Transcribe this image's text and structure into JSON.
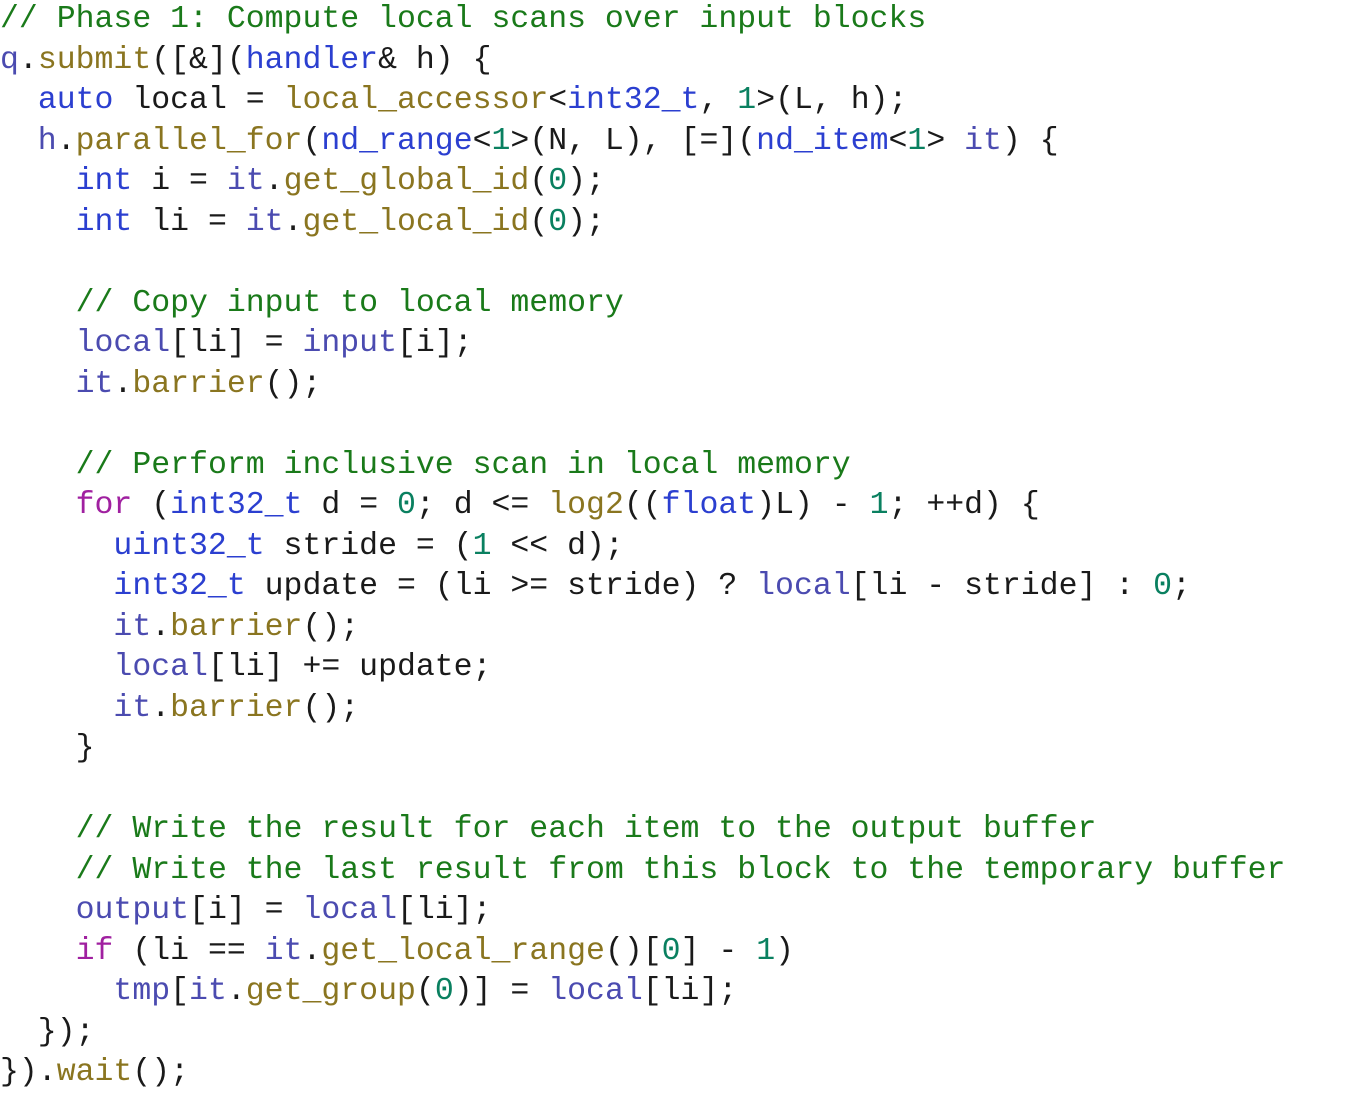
{
  "document": {
    "kind": "source-code-listing",
    "language": "C++ / SYCL",
    "background_color": "#ffffff",
    "theme": {
      "comment_color": "#1a7a1a",
      "keyword_color": "#2b3fd0",
      "control_keyword_color": "#a020a0",
      "function_color": "#8a7520",
      "identifier_color": "#4b4bb0",
      "number_color": "#0a8060",
      "plain_color": "#1a1a1a"
    }
  },
  "code": {
    "full_text": "// Phase 1: Compute local scans over input blocks\nq.submit([&](handler& h) {\n  auto local = local_accessor<int32_t, 1>(L, h);\n  h.parallel_for(nd_range<1>(N, L), [=](nd_item<1> it) {\n    int i = it.get_global_id(0);\n    int li = it.get_local_id(0);\n\n    // Copy input to local memory\n    local[li] = input[i];\n    it.barrier();\n\n    // Perform inclusive scan in local memory\n    for (int32_t d = 0; d <= log2((float)L) - 1; ++d) {\n      uint32_t stride = (1 << d);\n      int32_t update = (li >= stride) ? local[li - stride] : 0;\n      it.barrier();\n      local[li] += update;\n      it.barrier();\n    }\n\n    // Write the result for each item to the output buffer\n    // Write the last result from this block to the temporary buffer\n    output[i] = local[li];\n    if (li == it.get_local_range()[0] - 1)\n      tmp[it.get_group(0)] = local[li];\n  });\n}).wait();",
    "lines": [
      {
        "n": 1,
        "text": "// Phase 1: Compute local scans over input blocks",
        "tokens": [
          {
            "c": "cmt",
            "t": "// Phase 1: Compute local scans over input blocks"
          }
        ]
      },
      {
        "n": 2,
        "text": "q.submit([&](handler& h) {",
        "tokens": [
          {
            "c": "id",
            "t": "q"
          },
          {
            "c": "pl",
            "t": "."
          },
          {
            "c": "fn",
            "t": "submit"
          },
          {
            "c": "pl",
            "t": "([&]("
          },
          {
            "c": "kw",
            "t": "handler"
          },
          {
            "c": "pl",
            "t": "& h) {"
          }
        ]
      },
      {
        "n": 3,
        "text": "  auto local = local_accessor<int32_t, 1>(L, h);",
        "tokens": [
          {
            "c": "pl",
            "t": "  "
          },
          {
            "c": "kw",
            "t": "auto"
          },
          {
            "c": "pl",
            "t": " local = "
          },
          {
            "c": "fn",
            "t": "local_accessor"
          },
          {
            "c": "pl",
            "t": "<"
          },
          {
            "c": "kw",
            "t": "int32_t"
          },
          {
            "c": "pl",
            "t": ", "
          },
          {
            "c": "num",
            "t": "1"
          },
          {
            "c": "pl",
            "t": ">(L, h);"
          }
        ]
      },
      {
        "n": 4,
        "text": "  h.parallel_for(nd_range<1>(N, L), [=](nd_item<1> it) {",
        "tokens": [
          {
            "c": "id",
            "t": "  h"
          },
          {
            "c": "pl",
            "t": "."
          },
          {
            "c": "fn",
            "t": "parallel_for"
          },
          {
            "c": "pl",
            "t": "("
          },
          {
            "c": "kw",
            "t": "nd_range"
          },
          {
            "c": "pl",
            "t": "<"
          },
          {
            "c": "num",
            "t": "1"
          },
          {
            "c": "pl",
            "t": ">(N, L), [=]("
          },
          {
            "c": "kw",
            "t": "nd_item"
          },
          {
            "c": "pl",
            "t": "<"
          },
          {
            "c": "num",
            "t": "1"
          },
          {
            "c": "pl",
            "t": "> "
          },
          {
            "c": "id",
            "t": "it"
          },
          {
            "c": "pl",
            "t": ") {"
          }
        ]
      },
      {
        "n": 5,
        "text": "    int i = it.get_global_id(0);",
        "tokens": [
          {
            "c": "pl",
            "t": "    "
          },
          {
            "c": "kw",
            "t": "int"
          },
          {
            "c": "pl",
            "t": " i = "
          },
          {
            "c": "id",
            "t": "it"
          },
          {
            "c": "pl",
            "t": "."
          },
          {
            "c": "fn",
            "t": "get_global_id"
          },
          {
            "c": "pl",
            "t": "("
          },
          {
            "c": "num",
            "t": "0"
          },
          {
            "c": "pl",
            "t": ");"
          }
        ]
      },
      {
        "n": 6,
        "text": "    int li = it.get_local_id(0);",
        "tokens": [
          {
            "c": "pl",
            "t": "    "
          },
          {
            "c": "kw",
            "t": "int"
          },
          {
            "c": "pl",
            "t": " li = "
          },
          {
            "c": "id",
            "t": "it"
          },
          {
            "c": "pl",
            "t": "."
          },
          {
            "c": "fn",
            "t": "get_local_id"
          },
          {
            "c": "pl",
            "t": "("
          },
          {
            "c": "num",
            "t": "0"
          },
          {
            "c": "pl",
            "t": ");"
          }
        ]
      },
      {
        "n": 7,
        "text": "",
        "tokens": []
      },
      {
        "n": 8,
        "text": "    // Copy input to local memory",
        "tokens": [
          {
            "c": "pl",
            "t": "    "
          },
          {
            "c": "cmt",
            "t": "// Copy input to local memory"
          }
        ]
      },
      {
        "n": 9,
        "text": "    local[li] = input[i];",
        "tokens": [
          {
            "c": "pl",
            "t": "    "
          },
          {
            "c": "id",
            "t": "local"
          },
          {
            "c": "pl",
            "t": "[li] = "
          },
          {
            "c": "id",
            "t": "input"
          },
          {
            "c": "pl",
            "t": "[i];"
          }
        ]
      },
      {
        "n": 10,
        "text": "    it.barrier();",
        "tokens": [
          {
            "c": "pl",
            "t": "    "
          },
          {
            "c": "id",
            "t": "it"
          },
          {
            "c": "pl",
            "t": "."
          },
          {
            "c": "fn",
            "t": "barrier"
          },
          {
            "c": "pl",
            "t": "();"
          }
        ]
      },
      {
        "n": 11,
        "text": "",
        "tokens": []
      },
      {
        "n": 12,
        "text": "    // Perform inclusive scan in local memory",
        "tokens": [
          {
            "c": "pl",
            "t": "    "
          },
          {
            "c": "cmt",
            "t": "// Perform inclusive scan in local memory"
          }
        ]
      },
      {
        "n": 13,
        "text": "    for (int32_t d = 0; d <= log2((float)L) - 1; ++d) {",
        "tokens": [
          {
            "c": "pl",
            "t": "    "
          },
          {
            "c": "ctl",
            "t": "for"
          },
          {
            "c": "pl",
            "t": " ("
          },
          {
            "c": "kw",
            "t": "int32_t"
          },
          {
            "c": "pl",
            "t": " d = "
          },
          {
            "c": "num",
            "t": "0"
          },
          {
            "c": "pl",
            "t": "; d <= "
          },
          {
            "c": "fn",
            "t": "log2"
          },
          {
            "c": "pl",
            "t": "(("
          },
          {
            "c": "kw",
            "t": "float"
          },
          {
            "c": "pl",
            "t": ")L) - "
          },
          {
            "c": "num",
            "t": "1"
          },
          {
            "c": "pl",
            "t": "; ++d) {"
          }
        ]
      },
      {
        "n": 14,
        "text": "      uint32_t stride = (1 << d);",
        "tokens": [
          {
            "c": "pl",
            "t": "      "
          },
          {
            "c": "kw",
            "t": "uint32_t"
          },
          {
            "c": "pl",
            "t": " stride = ("
          },
          {
            "c": "num",
            "t": "1"
          },
          {
            "c": "pl",
            "t": " << d);"
          }
        ]
      },
      {
        "n": 15,
        "text": "      int32_t update = (li >= stride) ? local[li - stride] : 0;",
        "tokens": [
          {
            "c": "pl",
            "t": "      "
          },
          {
            "c": "kw",
            "t": "int32_t"
          },
          {
            "c": "pl",
            "t": " update = (li >= stride) ? "
          },
          {
            "c": "id",
            "t": "local"
          },
          {
            "c": "pl",
            "t": "[li - stride] : "
          },
          {
            "c": "num",
            "t": "0"
          },
          {
            "c": "pl",
            "t": ";"
          }
        ]
      },
      {
        "n": 16,
        "text": "      it.barrier();",
        "tokens": [
          {
            "c": "pl",
            "t": "      "
          },
          {
            "c": "id",
            "t": "it"
          },
          {
            "c": "pl",
            "t": "."
          },
          {
            "c": "fn",
            "t": "barrier"
          },
          {
            "c": "pl",
            "t": "();"
          }
        ]
      },
      {
        "n": 17,
        "text": "      local[li] += update;",
        "tokens": [
          {
            "c": "pl",
            "t": "      "
          },
          {
            "c": "id",
            "t": "local"
          },
          {
            "c": "pl",
            "t": "[li] += update;"
          }
        ]
      },
      {
        "n": 18,
        "text": "      it.barrier();",
        "tokens": [
          {
            "c": "pl",
            "t": "      "
          },
          {
            "c": "id",
            "t": "it"
          },
          {
            "c": "pl",
            "t": "."
          },
          {
            "c": "fn",
            "t": "barrier"
          },
          {
            "c": "pl",
            "t": "();"
          }
        ]
      },
      {
        "n": 19,
        "text": "    }",
        "tokens": [
          {
            "c": "pl",
            "t": "    }"
          }
        ]
      },
      {
        "n": 20,
        "text": "",
        "tokens": []
      },
      {
        "n": 21,
        "text": "    // Write the result for each item to the output buffer",
        "tokens": [
          {
            "c": "pl",
            "t": "    "
          },
          {
            "c": "cmt",
            "t": "// Write the result for each item to the output buffer"
          }
        ]
      },
      {
        "n": 22,
        "text": "    // Write the last result from this block to the temporary buffer",
        "tokens": [
          {
            "c": "pl",
            "t": "    "
          },
          {
            "c": "cmt",
            "t": "// Write the last result from this block to the temporary buffer"
          }
        ]
      },
      {
        "n": 23,
        "text": "    output[i] = local[li];",
        "tokens": [
          {
            "c": "pl",
            "t": "    "
          },
          {
            "c": "id",
            "t": "output"
          },
          {
            "c": "pl",
            "t": "[i] = "
          },
          {
            "c": "id",
            "t": "local"
          },
          {
            "c": "pl",
            "t": "[li];"
          }
        ]
      },
      {
        "n": 24,
        "text": "    if (li == it.get_local_range()[0] - 1)",
        "tokens": [
          {
            "c": "pl",
            "t": "    "
          },
          {
            "c": "ctl",
            "t": "if"
          },
          {
            "c": "pl",
            "t": " (li == "
          },
          {
            "c": "id",
            "t": "it"
          },
          {
            "c": "pl",
            "t": "."
          },
          {
            "c": "fn",
            "t": "get_local_range"
          },
          {
            "c": "pl",
            "t": "()["
          },
          {
            "c": "num",
            "t": "0"
          },
          {
            "c": "pl",
            "t": "] - "
          },
          {
            "c": "num",
            "t": "1"
          },
          {
            "c": "pl",
            "t": ")"
          }
        ]
      },
      {
        "n": 25,
        "text": "      tmp[it.get_group(0)] = local[li];",
        "tokens": [
          {
            "c": "pl",
            "t": "      "
          },
          {
            "c": "id",
            "t": "tmp"
          },
          {
            "c": "pl",
            "t": "["
          },
          {
            "c": "id",
            "t": "it"
          },
          {
            "c": "pl",
            "t": "."
          },
          {
            "c": "fn",
            "t": "get_group"
          },
          {
            "c": "pl",
            "t": "("
          },
          {
            "c": "num",
            "t": "0"
          },
          {
            "c": "pl",
            "t": ")] = "
          },
          {
            "c": "id",
            "t": "local"
          },
          {
            "c": "pl",
            "t": "[li];"
          }
        ]
      },
      {
        "n": 26,
        "text": "  });",
        "tokens": [
          {
            "c": "pl",
            "t": "  });"
          }
        ]
      },
      {
        "n": 27,
        "text": "}).wait();",
        "tokens": [
          {
            "c": "pl",
            "t": "})."
          },
          {
            "c": "fn",
            "t": "wait"
          },
          {
            "c": "pl",
            "t": "();"
          }
        ]
      }
    ]
  }
}
